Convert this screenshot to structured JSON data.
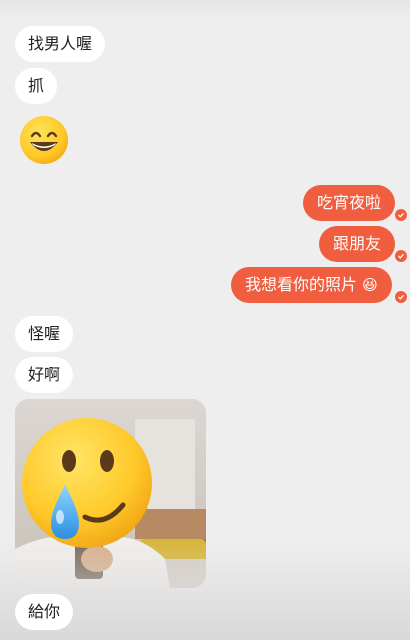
{
  "chat": {
    "incoming": {
      "msg1": "找男人喔",
      "msg2": "抓",
      "msg3_emoji": "grinning-face-emoji",
      "msg4": "怪喔",
      "msg5": "好啊",
      "msg6_photo": "selfie-photo-with-crying-smile-emoji",
      "msg7": "給你"
    },
    "outgoing": {
      "msg1": "吃宵夜啦",
      "msg2": "跟朋友",
      "msg3": "我想看你的照片",
      "msg3_emoji": "😆"
    }
  },
  "colors": {
    "background": "#eeeeee",
    "incoming_bubble": "#ffffff",
    "outgoing_bubble": "#f05e3f",
    "incoming_text": "#222222",
    "outgoing_text": "#ffffff"
  }
}
